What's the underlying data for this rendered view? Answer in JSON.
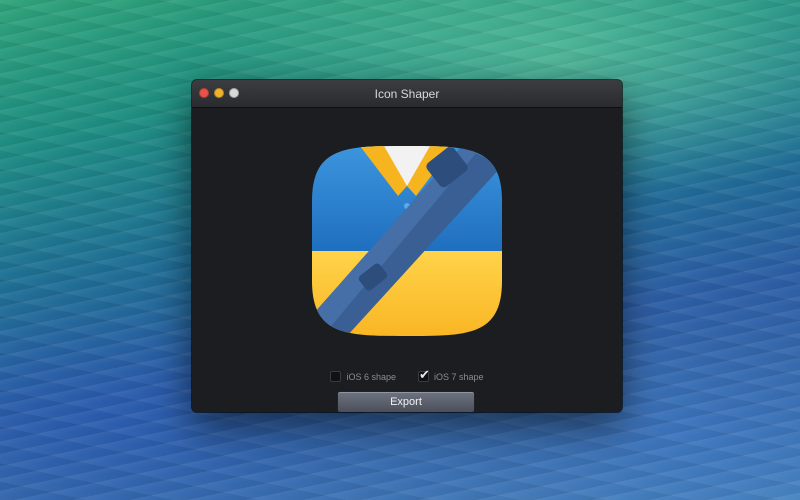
{
  "window": {
    "title": "Icon Shaper"
  },
  "icon": {
    "name": "app-preview-icon",
    "colors": {
      "top_blue": "#2f7fcc",
      "bottom_yellow": "#ffc93a",
      "strap": "#3a5f95",
      "collar": "#f6b51e"
    }
  },
  "options": [
    {
      "label": "iOS 6 shape",
      "checked": false
    },
    {
      "label": "iOS 7 shape",
      "checked": true
    }
  ],
  "buttons": {
    "export_label": "Export"
  }
}
